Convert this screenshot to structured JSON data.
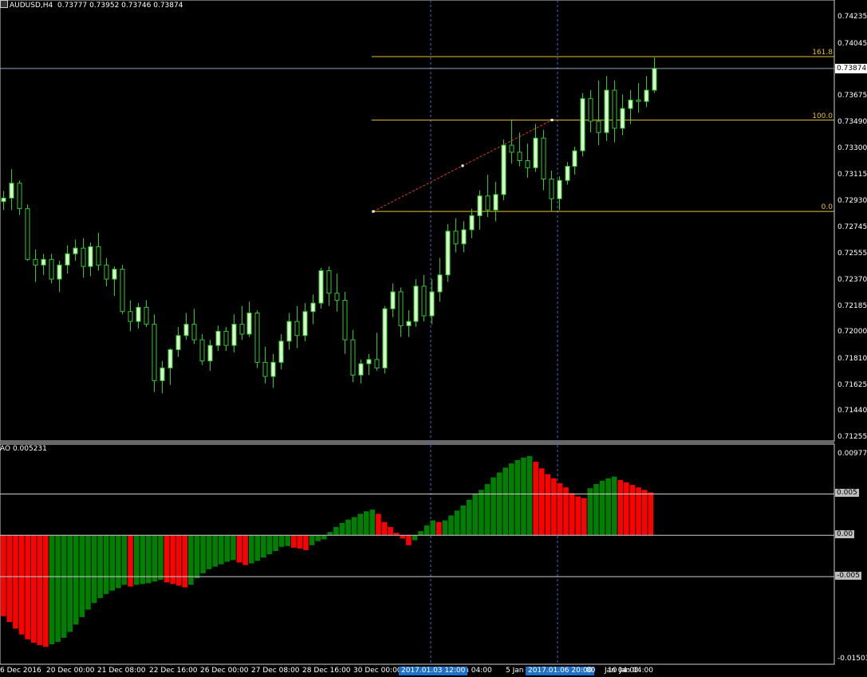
{
  "window": {
    "title": "AUDUSD,H4",
    "ohlc": "0.73777 0.73952 0.73746 0.73874"
  },
  "price_axis": {
    "ticks": [
      "0.74235",
      "0.74045",
      "0.73874",
      "0.73675",
      "0.73490",
      "0.73300",
      "0.73115",
      "0.72930",
      "0.72745",
      "0.72555",
      "0.72370",
      "0.72185",
      "0.72000",
      "0.71810",
      "0.71625",
      "0.71440",
      "0.71255"
    ],
    "current_price": "0.73874"
  },
  "fibonacci": {
    "levels": [
      {
        "label": "161.8",
        "price": 0.73958
      },
      {
        "label": "100.0",
        "price": 0.73508
      },
      {
        "label": "0.0",
        "price": 0.7286
      }
    ]
  },
  "indicator": {
    "title": "AO 0.005231",
    "axis_labels": [
      "0.009776",
      "0.005",
      "0.00",
      "-0.005",
      "-0.01503"
    ]
  },
  "time_axis": {
    "labels": [
      "6 Dec 2016",
      "20 Dec 00:00",
      "21 Dec 08:00",
      "22 Dec 16:00",
      "26 Dec 00:00",
      "27 Dec 08:00",
      "28 Dec 16:00",
      "30 Dec 00:00",
      "Jan 04:00",
      "5 Jan",
      "Jan 04:00"
    ],
    "highlighted": [
      "2017.01.03 12:00",
      "2017.01.06 20:00"
    ],
    "fragments": [
      "00",
      "10 Jan 04:00"
    ]
  },
  "colors": {
    "bull_candle": "#d8ffc8",
    "bear_candle": "#000000",
    "candle_wick": "#2fc82f",
    "ao_up": "#008000",
    "ao_down": "#ff0000",
    "fib_line": "#e8c232",
    "price_line": "#8da5c4",
    "grid_vline": "#3a68c8"
  },
  "chart_data": {
    "type": "candlestick",
    "symbol": "AUDUSD",
    "timeframe": "H4",
    "ylim": [
      0.71255,
      0.74235
    ],
    "candles": [
      [
        0.7293,
        0.73005,
        0.7287,
        0.72955
      ],
      [
        0.72955,
        0.7316,
        0.7287,
        0.7306
      ],
      [
        0.7306,
        0.7308,
        0.72835,
        0.7288
      ],
      [
        0.7288,
        0.7291,
        0.7251,
        0.7252
      ],
      [
        0.7252,
        0.7259,
        0.7236,
        0.7248
      ],
      [
        0.7248,
        0.7256,
        0.7241,
        0.7252
      ],
      [
        0.7252,
        0.7256,
        0.7235,
        0.7238
      ],
      [
        0.7238,
        0.7251,
        0.7229,
        0.7248
      ],
      [
        0.7248,
        0.7262,
        0.7242,
        0.7256
      ],
      [
        0.7256,
        0.7266,
        0.7251,
        0.726
      ],
      [
        0.726,
        0.7267,
        0.7239,
        0.7247
      ],
      [
        0.7247,
        0.7264,
        0.724,
        0.7261
      ],
      [
        0.7261,
        0.7271,
        0.7244,
        0.7248
      ],
      [
        0.7248,
        0.7253,
        0.7233,
        0.7238
      ],
      [
        0.7238,
        0.7247,
        0.7226,
        0.7245
      ],
      [
        0.7245,
        0.7248,
        0.7213,
        0.7215
      ],
      [
        0.7215,
        0.7223,
        0.7201,
        0.7208
      ],
      [
        0.7208,
        0.7221,
        0.7203,
        0.7218
      ],
      [
        0.7218,
        0.7223,
        0.7204,
        0.7206
      ],
      [
        0.7206,
        0.7213,
        0.7158,
        0.7166
      ],
      [
        0.7166,
        0.718,
        0.7157,
        0.7175
      ],
      [
        0.7175,
        0.7189,
        0.7163,
        0.7188
      ],
      [
        0.7188,
        0.7204,
        0.7183,
        0.7198
      ],
      [
        0.7198,
        0.7214,
        0.7195,
        0.7206
      ],
      [
        0.7206,
        0.7217,
        0.7192,
        0.7195
      ],
      [
        0.7195,
        0.7199,
        0.7177,
        0.718
      ],
      [
        0.718,
        0.7195,
        0.7173,
        0.7191
      ],
      [
        0.7191,
        0.7205,
        0.7187,
        0.7201
      ],
      [
        0.7201,
        0.7204,
        0.7187,
        0.7191
      ],
      [
        0.7191,
        0.7213,
        0.7186,
        0.7206
      ],
      [
        0.7206,
        0.7219,
        0.7195,
        0.7199
      ],
      [
        0.7199,
        0.7222,
        0.7197,
        0.7214
      ],
      [
        0.7214,
        0.7216,
        0.7175,
        0.7179
      ],
      [
        0.7179,
        0.719,
        0.7164,
        0.7169
      ],
      [
        0.7169,
        0.7185,
        0.7161,
        0.7179
      ],
      [
        0.7179,
        0.7199,
        0.7174,
        0.7194
      ],
      [
        0.7194,
        0.7214,
        0.7188,
        0.7208
      ],
      [
        0.7208,
        0.7219,
        0.7189,
        0.7198
      ],
      [
        0.7198,
        0.7221,
        0.7194,
        0.7215
      ],
      [
        0.7215,
        0.7227,
        0.7206,
        0.7221
      ],
      [
        0.7221,
        0.7246,
        0.7217,
        0.7244
      ],
      [
        0.7244,
        0.7247,
        0.7219,
        0.7228
      ],
      [
        0.7228,
        0.7242,
        0.7215,
        0.7223
      ],
      [
        0.7223,
        0.7229,
        0.7185,
        0.7195
      ],
      [
        0.7195,
        0.7202,
        0.7165,
        0.717
      ],
      [
        0.717,
        0.7181,
        0.7164,
        0.7178
      ],
      [
        0.7178,
        0.7185,
        0.717,
        0.7181
      ],
      [
        0.7181,
        0.72,
        0.7173,
        0.7175
      ],
      [
        0.7175,
        0.7219,
        0.7171,
        0.7217
      ],
      [
        0.7217,
        0.7235,
        0.7211,
        0.7229
      ],
      [
        0.7229,
        0.7232,
        0.7197,
        0.7205
      ],
      [
        0.7205,
        0.7216,
        0.7197,
        0.7208
      ],
      [
        0.7208,
        0.7238,
        0.7204,
        0.7233
      ],
      [
        0.7233,
        0.7241,
        0.7208,
        0.7212
      ],
      [
        0.7212,
        0.7238,
        0.7206,
        0.7229
      ],
      [
        0.7229,
        0.7253,
        0.7222,
        0.7241
      ],
      [
        0.7241,
        0.7277,
        0.7236,
        0.7272
      ],
      [
        0.7272,
        0.7281,
        0.7257,
        0.7263
      ],
      [
        0.7263,
        0.7279,
        0.7257,
        0.7273
      ],
      [
        0.7273,
        0.7288,
        0.7267,
        0.7283
      ],
      [
        0.7283,
        0.7301,
        0.7273,
        0.7297
      ],
      [
        0.7297,
        0.7312,
        0.7282,
        0.7287
      ],
      [
        0.7287,
        0.7307,
        0.7279,
        0.7298
      ],
      [
        0.7298,
        0.7337,
        0.7294,
        0.7333
      ],
      [
        0.7333,
        0.7351,
        0.732,
        0.7328
      ],
      [
        0.7328,
        0.7342,
        0.7318,
        0.7322
      ],
      [
        0.7322,
        0.7334,
        0.731,
        0.7317
      ],
      [
        0.7317,
        0.7348,
        0.7314,
        0.7338
      ],
      [
        0.7338,
        0.7344,
        0.7301,
        0.7309
      ],
      [
        0.7309,
        0.7315,
        0.7286,
        0.7295
      ],
      [
        0.7295,
        0.7311,
        0.7287,
        0.7308
      ],
      [
        0.7308,
        0.7321,
        0.7305,
        0.7318
      ],
      [
        0.7318,
        0.7332,
        0.7312,
        0.7329
      ],
      [
        0.7329,
        0.737,
        0.7325,
        0.7366
      ],
      [
        0.7366,
        0.7372,
        0.7342,
        0.735
      ],
      [
        0.735,
        0.7379,
        0.7333,
        0.7342
      ],
      [
        0.7342,
        0.7382,
        0.7336,
        0.7372
      ],
      [
        0.7372,
        0.7379,
        0.7335,
        0.7345
      ],
      [
        0.7345,
        0.7369,
        0.734,
        0.7359
      ],
      [
        0.7359,
        0.7372,
        0.7348,
        0.7365
      ],
      [
        0.7365,
        0.7377,
        0.7356,
        0.7364
      ],
      [
        0.7364,
        0.7382,
        0.736,
        0.7372
      ],
      [
        0.7372,
        0.7395,
        0.737,
        0.73874
      ]
    ],
    "ao": [
      -0.0098,
      -0.0105,
      -0.0113,
      -0.012,
      -0.0126,
      -0.013,
      -0.0133,
      -0.0135,
      -0.0132,
      -0.0129,
      -0.0124,
      -0.0117,
      -0.0108,
      -0.0099,
      -0.009,
      -0.0082,
      -0.0076,
      -0.0071,
      -0.0067,
      -0.0064,
      -0.006,
      -0.0062,
      -0.006,
      -0.0059,
      -0.0058,
      -0.0056,
      -0.0054,
      -0.0057,
      -0.0059,
      -0.0061,
      -0.0063,
      -0.006,
      -0.0052,
      -0.0046,
      -0.0041,
      -0.0038,
      -0.0035,
      -0.0032,
      -0.003,
      -0.0033,
      -0.0036,
      -0.0034,
      -0.0031,
      -0.0027,
      -0.0023,
      -0.0019,
      -0.0014,
      -0.0013,
      -0.0015,
      -0.0016,
      -0.0018,
      -0.0012,
      -0.0007,
      -0.0005,
      0.0004,
      0.001,
      0.0015,
      0.0019,
      0.0022,
      0.0026,
      0.0029,
      0.0031,
      0.0026,
      0.0016,
      0.001,
      0.0003,
      -0.0004,
      -0.0012,
      -0.0006,
      0.0005,
      0.0012,
      0.0018,
      0.0016,
      0.0018,
      0.0024,
      0.003,
      0.0036,
      0.0043,
      0.005,
      0.0055,
      0.0062,
      0.007,
      0.0076,
      0.0082,
      0.0087,
      0.0091,
      0.0094,
      0.0096,
      0.0089,
      0.0081,
      0.0074,
      0.0069,
      0.0063,
      0.0058,
      0.0051,
      0.0047,
      0.0045,
      0.0057,
      0.0062,
      0.0066,
      0.0069,
      0.0071,
      0.0067,
      0.0064,
      0.0061,
      0.0058,
      0.0055,
      0.0052
    ]
  }
}
